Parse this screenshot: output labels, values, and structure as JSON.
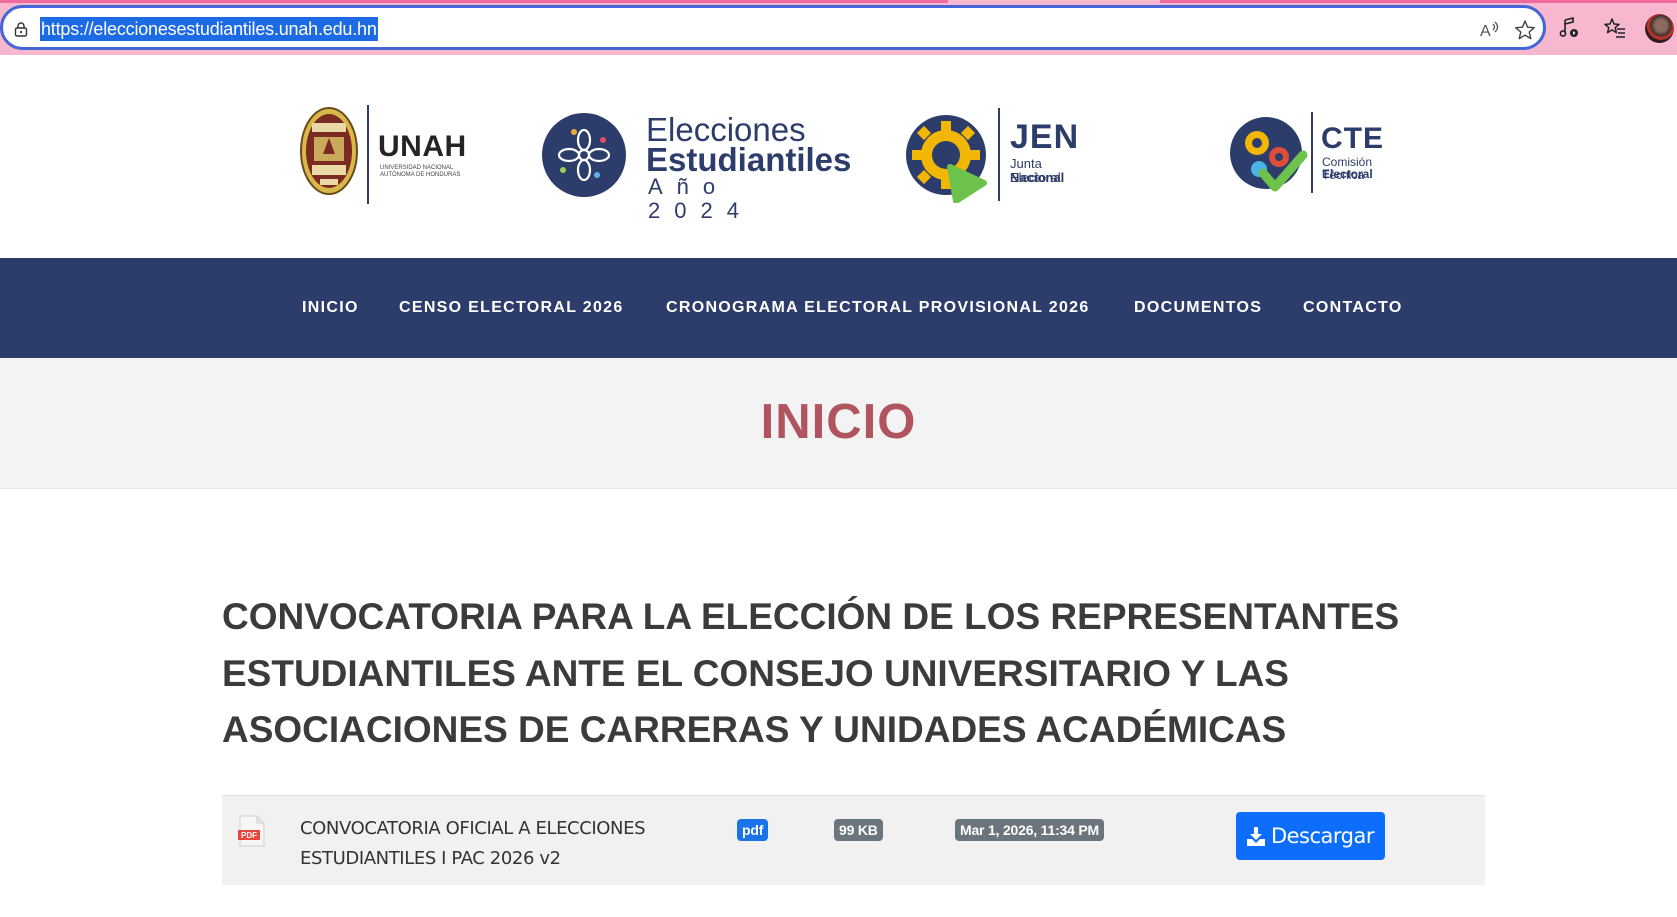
{
  "browser": {
    "url": "https://eleccionesestudiantiles.unah.edu.hn",
    "icons": [
      "lock-icon",
      "read-aloud-icon",
      "favorite-star-icon",
      "media-control-icon",
      "favorites-list-icon",
      "profile-avatar"
    ]
  },
  "logos": {
    "unah": {
      "word": "UNAH",
      "sub": "Universidad Nacional Autónoma de Honduras"
    },
    "elecciones": {
      "line1": "Elecciones",
      "line2": "Estudiantiles",
      "line3": "Año 2024"
    },
    "jen": {
      "word": "JEN",
      "sub1": "Junta Electoral",
      "sub2": "Nacional"
    },
    "cte": {
      "word": "CTE",
      "sub1": "Comisión Técnica",
      "sub2": "Electoral"
    }
  },
  "nav": {
    "items": [
      {
        "label": "INICIO"
      },
      {
        "label": "CENSO ELECTORAL 2026"
      },
      {
        "label": "CRONOGRAMA ELECTORAL PROVISIONAL 2026"
      },
      {
        "label": "DOCUMENTOS"
      },
      {
        "label": "CONTACTO"
      }
    ]
  },
  "page": {
    "title": "INICIO"
  },
  "main": {
    "heading": "CONVOCATORIA PARA LA ELECCIÓN DE LOS REPRESENTANTES ESTUDIANTILES ANTE EL CONSEJO UNIVERSITARIO Y LAS ASOCIACIONES DE CARRERAS Y UNIDADES ACADÉMICAS",
    "document": {
      "icon_label": "PDF",
      "title": "CONVOCATORIA OFICIAL A ELECCIONES ESTUDIANTILES I PAC 2026 v2",
      "type": "pdf",
      "size": "99 KB",
      "date": "Mar 1, 2026, 11:34 PM",
      "download_label": "Descargar"
    }
  },
  "colors": {
    "nav_bg": "#2d3d6b",
    "title_color": "#b05560",
    "button_bg": "#0d6efd",
    "browser_frame": "#f6b7cf"
  }
}
